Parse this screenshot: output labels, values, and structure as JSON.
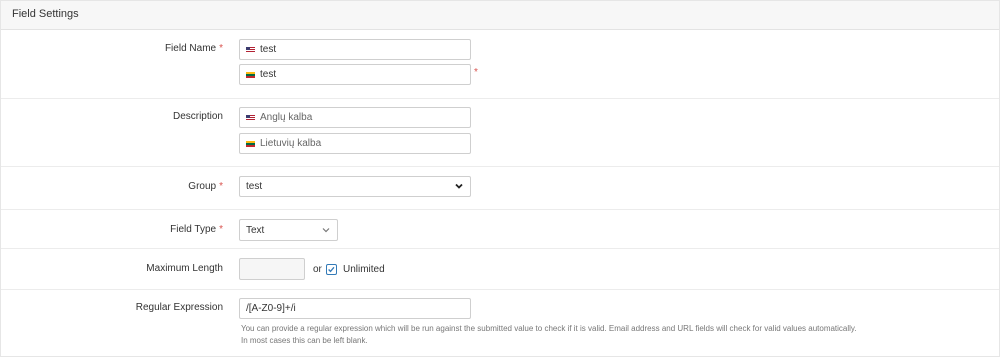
{
  "panel": {
    "title": "Field Settings"
  },
  "field_name": {
    "label": "Field Name",
    "required_mark": "*",
    "values": [
      {
        "flag": "us-flag-icon",
        "value": "test"
      },
      {
        "flag": "lt-flag-icon",
        "value": "test"
      }
    ],
    "side_required_mark": "*"
  },
  "description": {
    "label": "Description",
    "placeholders": [
      "Anglų kalba",
      "Lietuvių kalba"
    ]
  },
  "group": {
    "label": "Group",
    "required_mark": "*",
    "selected": "test"
  },
  "field_type": {
    "label": "Field Type",
    "required_mark": "*",
    "selected": "Text"
  },
  "max_length": {
    "label": "Maximum Length",
    "value": "",
    "or_text": "or",
    "unlimited_label": "Unlimited",
    "unlimited_checked": true
  },
  "regex": {
    "label": "Regular Expression",
    "value": "/[A-Z0-9]+/i",
    "help_line1": "You can provide a regular expression which will be run against the submitted value to check if it is valid. Email address and URL fields will check for valid values automatically.",
    "help_line2": "In most cases this can be left blank."
  },
  "colors": {
    "required": "#d9534f",
    "checkbox": "#337ab7"
  }
}
